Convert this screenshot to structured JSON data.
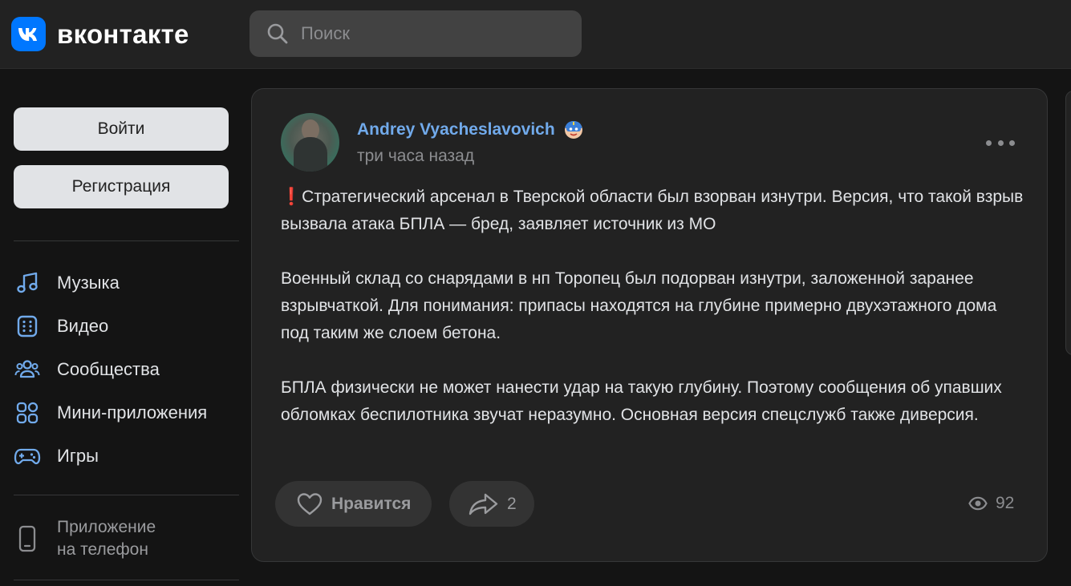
{
  "header": {
    "logo_text": "вконтакте",
    "search_placeholder": "Поиск"
  },
  "sidebar": {
    "login_label": "Войти",
    "register_label": "Регистрация",
    "items": [
      {
        "label": "Музыка",
        "icon": "music-note-icon"
      },
      {
        "label": "Видео",
        "icon": "video-icon"
      },
      {
        "label": "Сообщества",
        "icon": "users-icon"
      },
      {
        "label": "Мини-приложения",
        "icon": "apps-grid-icon"
      },
      {
        "label": "Игры",
        "icon": "gamepad-icon"
      }
    ],
    "app_promo": {
      "line1": "Приложение",
      "line2": "на телефон",
      "icon": "phone-icon"
    }
  },
  "post": {
    "author_name": "Andrey Vyacheslavovich",
    "time": "три часа назад",
    "paragraphs": [
      "Стратегический арсенал в Тверской области был взорван изнутри. Версия, что такой взрыв вызвала атака БПЛА — бред, заявляет источник из МО",
      "Военный склад со снарядами в нп Торопец был подорван изнутри, заложенной заранее взрывчаткой. Для понимания: припасы находятся на глубине примерно двухэтажного дома под таким же слоем бетона.",
      "БПЛА физически не может нанести удар на такую глубину. Поэтому сообщения об упавших обломках беспилотника звучат неразумно. Основная версия спецслужб также диверсия."
    ],
    "like_label": "Нравится",
    "share_count": "2",
    "views_count": "92"
  },
  "colors": {
    "accent": "#0077ff",
    "link": "#71aaeb",
    "background": "#141414",
    "card": "#222222"
  }
}
